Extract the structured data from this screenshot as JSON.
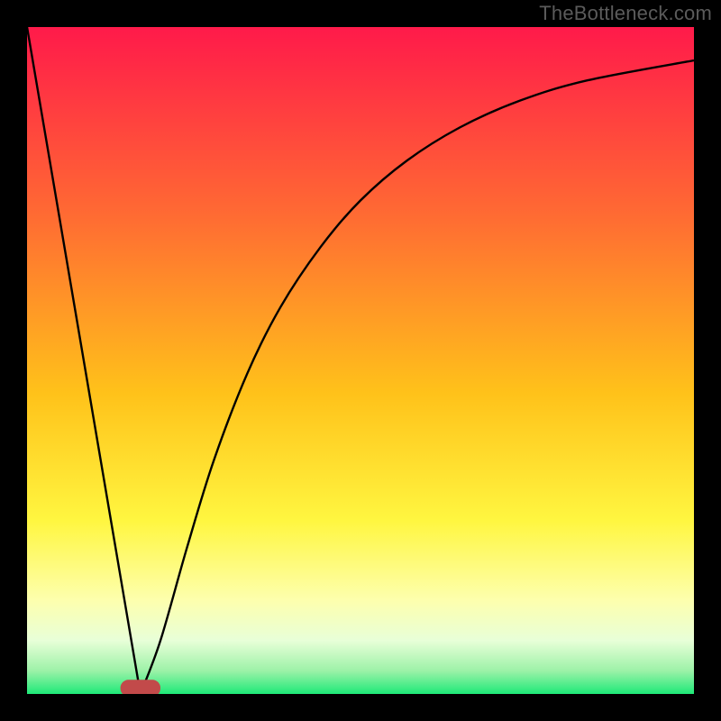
{
  "watermark": "TheBottleneck.com",
  "colors": {
    "frame": "#000000",
    "gradient_top": "#ff1a4a",
    "gradient_mid_upper": "#ff7b2e",
    "gradient_mid": "#ffd200",
    "gradient_mid_lower": "#ffff66",
    "gradient_band": "#f6ffd2",
    "gradient_bottom": "#1ee978",
    "curve": "#000000",
    "marker_fill": "#c24a4a"
  },
  "chart_data": {
    "type": "line",
    "xlabel": "",
    "ylabel": "",
    "xlim": [
      0,
      100
    ],
    "ylim": [
      0,
      100
    ],
    "grid": false,
    "marker": {
      "x": 17,
      "width": 6,
      "height": 2.5,
      "radius": 1.2
    },
    "left_line": {
      "x0": 0,
      "y0": 100,
      "x1": 17,
      "y1": 0
    },
    "right_curve": {
      "comment": "Estimated points on the rising curve from the vertex to the right edge; y as fraction of plot height (0 bottom, 100 top).",
      "points": [
        {
          "x": 17,
          "y": 0
        },
        {
          "x": 20,
          "y": 8
        },
        {
          "x": 24,
          "y": 22
        },
        {
          "x": 28,
          "y": 35
        },
        {
          "x": 33,
          "y": 48
        },
        {
          "x": 38,
          "y": 58
        },
        {
          "x": 44,
          "y": 67
        },
        {
          "x": 50,
          "y": 74
        },
        {
          "x": 57,
          "y": 80
        },
        {
          "x": 65,
          "y": 85
        },
        {
          "x": 74,
          "y": 89
        },
        {
          "x": 84,
          "y": 92
        },
        {
          "x": 100,
          "y": 95
        }
      ]
    }
  }
}
